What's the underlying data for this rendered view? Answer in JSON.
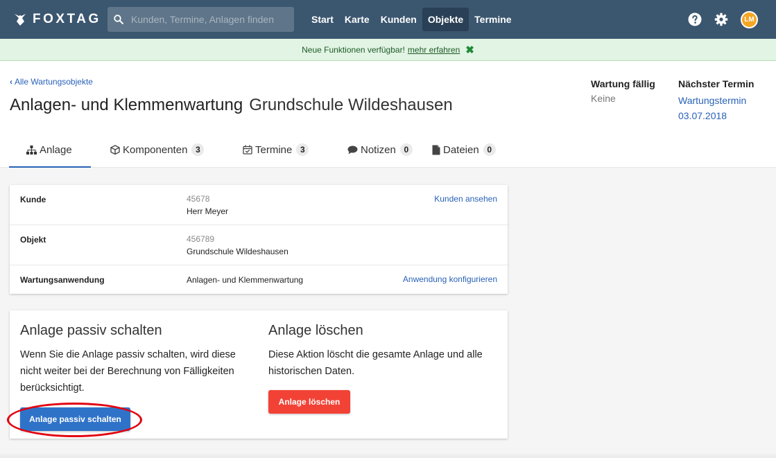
{
  "navbar": {
    "logo_text": "FOXTAG",
    "search_placeholder": "Kunden, Termine, Anlagen finden",
    "links": [
      "Start",
      "Karte",
      "Kunden",
      "Objekte",
      "Termine"
    ],
    "active_link": "Objekte",
    "avatar_initials": "LM",
    "colors": {
      "navbar": "#3b566f",
      "avatar": "#f5a623"
    }
  },
  "notice": {
    "text": "Neue Funktionen verfügbar!",
    "link": "mehr erfahren",
    "close_icon": "close-icon"
  },
  "header": {
    "back_link": "Alle Wartungsobjekte",
    "title": "Anlagen- und Klemmenwartung",
    "subtitle": "Grundschule Wildeshausen",
    "due_label": "Wartung fällig",
    "due_value": "Keine",
    "next_label": "Nächster Termin",
    "next_link_line1": "Wartungstermin",
    "next_link_line2": "03.07.2018"
  },
  "tabs": [
    {
      "label": "Anlage",
      "icon": "sitemap-icon",
      "count": null,
      "active": true
    },
    {
      "label": "Komponenten",
      "icon": "cube-icon",
      "count": "3"
    },
    {
      "label": "Termine",
      "icon": "calendar-check-icon",
      "count": "3"
    },
    {
      "label": "Notizen",
      "icon": "comment-icon",
      "count": "0"
    },
    {
      "label": "Dateien",
      "icon": "file-icon",
      "count": "0"
    }
  ],
  "info": {
    "kunde": {
      "label": "Kunde",
      "number": "45678",
      "name": "Herr Meyer",
      "action": "Kunden ansehen"
    },
    "objekt": {
      "label": "Objekt",
      "number": "456789",
      "name": "Grundschule Wildeshausen"
    },
    "anwendung": {
      "label": "Wartungsanwendung",
      "value": "Anlagen- und Klemmenwartung",
      "action": "Anwendung konfigurieren"
    }
  },
  "actions": {
    "passive": {
      "heading": "Anlage passiv schalten",
      "text": "Wenn Sie die Anlage passiv schalten, wird diese nicht weiter bei der Berechnung von Fälligkeiten berücksichtigt.",
      "button": "Anlage passiv schalten"
    },
    "delete": {
      "heading": "Anlage löschen",
      "text": "Diese Aktion löscht die gesamte Anlage und alle historischen Daten.",
      "button": "Anlage löschen"
    },
    "colors": {
      "primary": "#2f73c8",
      "danger": "#f24236",
      "highlight_ring": "#e3000f"
    }
  }
}
